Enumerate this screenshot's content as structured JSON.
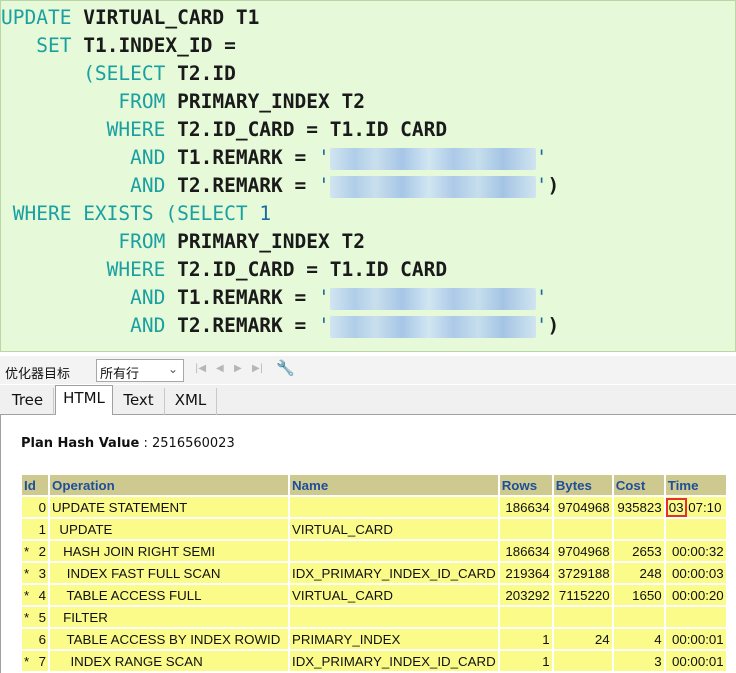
{
  "sql": {
    "lines": [
      {
        "t": "UPDATE VIRTUAL_CARD T1"
      },
      {
        "t": "   SET T1.INDEX_ID ="
      },
      {
        "t": "       (SELECT T2.ID"
      },
      {
        "t": "          FROM PRIMARY_INDEX T2"
      },
      {
        "t": "         WHERE T2.ID_CARD = T1.ID CARD"
      },
      {
        "t": "           AND T1.REMARK = '"
      },
      {
        "t": "           AND T2.REMARK = '"
      },
      {
        "t": " WHERE EXISTS (SELECT 1"
      },
      {
        "t": "          FROM PRIMARY_INDEX T2"
      },
      {
        "t": "         WHERE T2.ID_CARD = T1.ID CARD"
      },
      {
        "t": "           AND T1.REMARK = '"
      },
      {
        "t": "           AND T2.REMARK = '"
      }
    ]
  },
  "toolbar": {
    "optimizer_label": "优化器目标",
    "mode_value": "所有行",
    "nav_first": "|◀",
    "nav_prev": "◀",
    "nav_next": "▶",
    "nav_last": "▶|"
  },
  "tabs": [
    {
      "label": "Tree"
    },
    {
      "label": "HTML"
    },
    {
      "label": "Text"
    },
    {
      "label": "XML"
    }
  ],
  "plan": {
    "hash_label": "Plan Hash Value",
    "hash_value": ": 2516560023",
    "headers": [
      "Id",
      "Operation",
      "Name",
      "Rows",
      "Bytes",
      "Cost",
      "Time"
    ],
    "rows": [
      {
        "star": "",
        "id": "0",
        "op": "UPDATE STATEMENT",
        "name": "",
        "rows": "186634",
        "bytes": "9704968",
        "cost": "935823",
        "time_hl": "03",
        "time": " 07:10"
      },
      {
        "star": "",
        "id": "1",
        "op": "  UPDATE",
        "name": "VIRTUAL_CARD",
        "rows": "",
        "bytes": "",
        "cost": "",
        "time_hl": "",
        "time": ""
      },
      {
        "star": "*",
        "id": "2",
        "op": "   HASH JOIN RIGHT SEMI",
        "name": "",
        "rows": "186634",
        "bytes": "9704968",
        "cost": "2653",
        "time_hl": "",
        "time": "00:00:32"
      },
      {
        "star": "*",
        "id": "3",
        "op": "    INDEX FAST FULL SCAN",
        "name": "IDX_PRIMARY_INDEX_ID_CARD",
        "rows": "219364",
        "bytes": "3729188",
        "cost": "248",
        "time_hl": "",
        "time": "00:00:03"
      },
      {
        "star": "*",
        "id": "4",
        "op": "    TABLE ACCESS FULL",
        "name": "VIRTUAL_CARD",
        "rows": "203292",
        "bytes": "7115220",
        "cost": "1650",
        "time_hl": "",
        "time": "00:00:20"
      },
      {
        "star": "*",
        "id": "5",
        "op": "   FILTER",
        "name": "",
        "rows": "",
        "bytes": "",
        "cost": "",
        "time_hl": "",
        "time": ""
      },
      {
        "star": "",
        "id": "6",
        "op": "    TABLE ACCESS BY INDEX ROWID",
        "name": "PRIMARY_INDEX",
        "rows": "1",
        "bytes": "24",
        "cost": "4",
        "time_hl": "",
        "time": "00:00:01"
      },
      {
        "star": "*",
        "id": "7",
        "op": "     INDEX RANGE SCAN",
        "name": "IDX_PRIMARY_INDEX_ID_CARD",
        "rows": "1",
        "bytes": "",
        "cost": "3",
        "time_hl": "",
        "time": "00:00:01"
      }
    ]
  }
}
